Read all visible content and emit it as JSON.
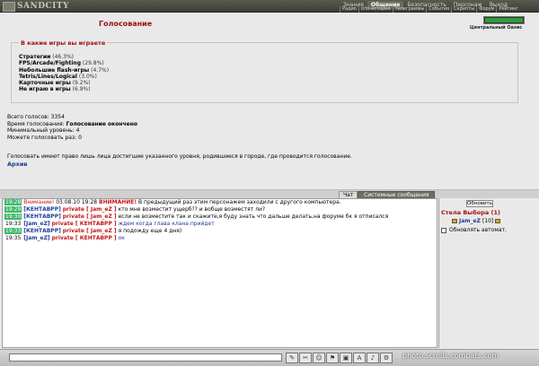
{
  "header": {
    "logo_text": "SANDCITY",
    "menu": [
      "Знания",
      "Общение",
      "Безопасность",
      "Персонаж",
      "Выход"
    ],
    "submenu": [
      "Радио",
      "info-история",
      "Телеграммы",
      "События",
      "Скрипты",
      "Форум",
      "Рейтинг"
    ],
    "location": "Центральный Оазис"
  },
  "page": {
    "title": "Голосование",
    "question": "В какие игры вы играете",
    "options": [
      {
        "name": "Стратегии",
        "pct": "(46.3%)"
      },
      {
        "name": "FPS/Arcade/Fighting",
        "pct": "(29.8%)"
      },
      {
        "name": "Небольшие flash-игры",
        "pct": "(4.7%)"
      },
      {
        "name": "Tetris/Lines/Logical",
        "pct": "(3.0%)"
      },
      {
        "name": "Карточные игры",
        "pct": "(9.2%)"
      },
      {
        "name": "Не играю в игры",
        "pct": "(6.9%)"
      }
    ],
    "total_votes_label": "Всего голосов:",
    "total_votes": "3354",
    "voting_time_label": "Время голосования:",
    "voting_time": "Голосование окончено",
    "min_level_label": "Минимальный уровень:",
    "min_level": "4",
    "can_vote_label": "Можете голосовать раз:",
    "can_vote": "0",
    "notice": "Голосовать имеют право лишь лица достигшие указанного уровня, родившиеся в городе, где проводится голосование.",
    "archive": "Архив"
  },
  "tabs": {
    "chat": "Чат",
    "system": "Системные сообщения"
  },
  "chat": {
    "messages": [
      {
        "time": "19:28",
        "hl": true,
        "prefix": "Внимание!",
        "text": " 03.08.10 19:28 ",
        "strong": "ВНИМАНИЕ!",
        "tail": " В предыдущий раз этим персонажем заходили с другого компьютера."
      },
      {
        "time": "19:29",
        "hl": true,
        "from": "[КЕНТАВРР]",
        "priv": "private [ Jam_eZ ]",
        "text": " кто мне возместит ущерб?? и вобще возместят ли?"
      },
      {
        "time": "19:30",
        "hl": true,
        "from": "[КЕНТАВРР]",
        "priv": "private [ Jam_eZ ]",
        "text": " если не возместите так и скажите,я буду знать что дальше делать,на форуме бк я отписался"
      },
      {
        "time": "19:33",
        "hl": false,
        "from": "[Jam_eZ]",
        "priv": "private [ КЕНТАВРР ]",
        "blue": " ждем когда глава клана прийдет"
      },
      {
        "time": "19:33",
        "hl": true,
        "from": "[КЕНТАВРР]",
        "priv": "private [ Jam_eZ ]",
        "text": " я подожду еще 4 дня)"
      },
      {
        "time": "19:35",
        "hl": false,
        "from": "[Jam_eZ]",
        "priv": "private [ КЕНТАВРР ]",
        "blue": " ок"
      }
    ]
  },
  "right_pane": {
    "refresh": "Обновить",
    "stela": "Стела Выбора (1)",
    "user": "Jam_eZ",
    "user_level": "[10]",
    "auto_refresh": "Обновлять автомат."
  },
  "footer": {
    "watermark": "photo.scrolls.combats.com"
  },
  "colors": {
    "accent_red": "#a01010",
    "link_blue": "#1f3d9a",
    "timestamp_green": "#3fb76a"
  }
}
